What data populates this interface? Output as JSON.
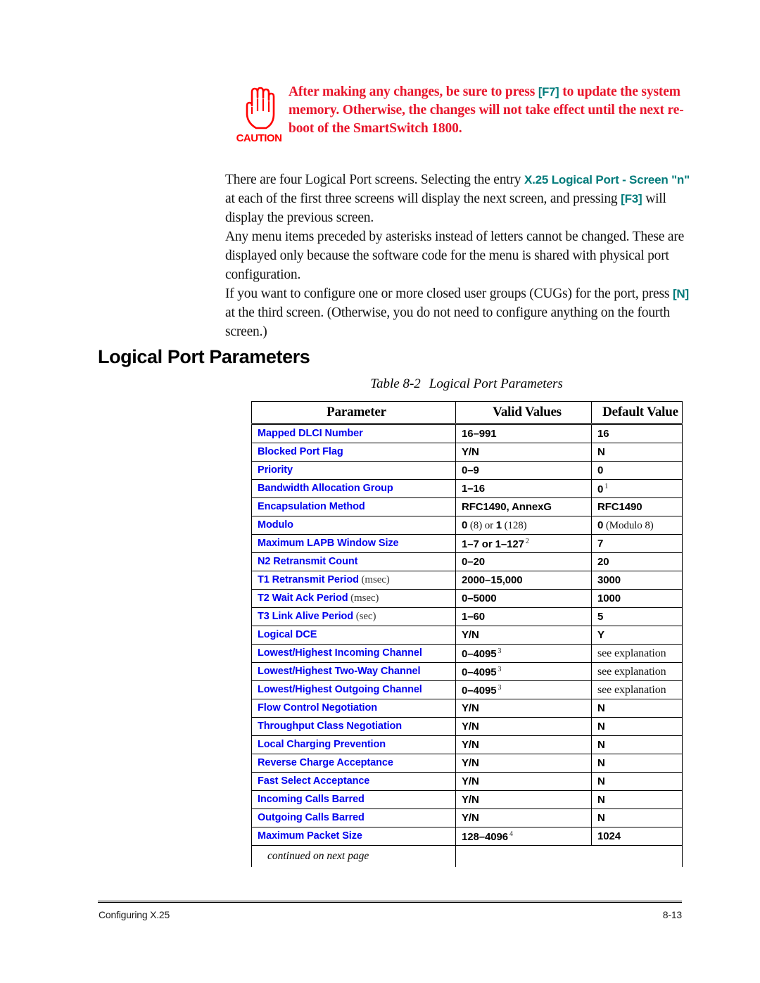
{
  "colors": {
    "caution_red": "#e8152a",
    "key_teal": "#007a7a",
    "param_blue": "#0000ee",
    "text_black": "#000000"
  },
  "caution": {
    "icon_name": "caution-hand-icon",
    "icon_label": "CAUTION",
    "text_part1": "After making any changes, be sure to press ",
    "key1": "[F7]",
    "text_part2": " to update the system memory. Otherwise, the changes will not take effect until the next re-boot of the SmartSwitch 1800."
  },
  "paragraphs": [
    {
      "id": "para1",
      "part1": "There are four Logical Port screens. Selecting the entry ",
      "kw1": "X.25 Logical Port - Screen \"n\"",
      "part2": " at each of the first three screens will display the next screen, and pressing ",
      "kw2": "[F3]",
      "part3": " will display the previous screen."
    },
    {
      "id": "para2",
      "part1": "Any menu items preceded by asterisks instead of letters cannot be changed. These are displayed only because the software code for the menu is shared with physical port configuration.",
      "kw1": "",
      "part2": "",
      "kw2": "",
      "part3": ""
    },
    {
      "id": "para3",
      "part1": "If you want to configure one or more closed user groups (CUGs) for the port, press ",
      "kw1": "[N]",
      "part2": " at the third screen. (Otherwise, you do not need to configure anything on the fourth screen.)",
      "kw2": "",
      "part3": ""
    }
  ],
  "section": {
    "heading": "Logical Port Parameters"
  },
  "table": {
    "caption_number": "Table 8-2",
    "caption_title": "Logical Port Parameters",
    "headers": [
      "Parameter",
      "Valid Values",
      "Default Value"
    ],
    "continued_note": "continued on next page",
    "rows": [
      {
        "param": "Mapped DLCI Number",
        "unit": "",
        "valid": "16–991",
        "valid_sup": "",
        "valid_note": "",
        "default": "16",
        "default_sup": "",
        "default_note": ""
      },
      {
        "param": "Blocked Port Flag",
        "unit": "",
        "valid": "Y/N",
        "valid_sup": "",
        "valid_note": "",
        "default": "N",
        "default_sup": "",
        "default_note": ""
      },
      {
        "param": "Priority",
        "unit": "",
        "valid": "0–9",
        "valid_sup": "",
        "valid_note": "",
        "default": "0",
        "default_sup": "",
        "default_note": ""
      },
      {
        "param": "Bandwidth Allocation Group",
        "unit": "",
        "valid": "1–16",
        "valid_sup": "",
        "valid_note": "",
        "default": "0",
        "default_sup": "1",
        "default_note": ""
      },
      {
        "param": "Encapsulation Method",
        "unit": "",
        "valid": "RFC1490, AnnexG",
        "valid_sup": "",
        "valid_note": "",
        "default": "RFC1490",
        "default_sup": "",
        "default_note": ""
      },
      {
        "param": "Modulo",
        "unit": "",
        "valid": "0",
        "valid_sup": "",
        "valid_note": " (8) or ",
        "default": "0",
        "default_sup": "",
        "default_note": " (Modulo 8)",
        "valid_extra_bold": "1",
        "valid_extra_note": " (128)"
      },
      {
        "param": "Maximum LAPB Window Size",
        "unit": "",
        "valid": "1–7 or 1–127",
        "valid_sup": "2",
        "valid_note": "",
        "default": "7",
        "default_sup": "",
        "default_note": ""
      },
      {
        "param": "N2 Retransmit Count",
        "unit": "",
        "valid": "0–20",
        "valid_sup": "",
        "valid_note": "",
        "default": "20",
        "default_sup": "",
        "default_note": ""
      },
      {
        "param": "T1 Retransmit Period",
        "unit": " (msec)",
        "valid": "2000–15,000",
        "valid_sup": "",
        "valid_note": "",
        "default": "3000",
        "default_sup": "",
        "default_note": ""
      },
      {
        "param": "T2 Wait Ack Period",
        "unit": " (msec)",
        "valid": "0–5000",
        "valid_sup": "",
        "valid_note": "",
        "default": "1000",
        "default_sup": "",
        "default_note": ""
      },
      {
        "param": "T3 Link Alive Period",
        "unit": " (sec)",
        "valid": "1–60",
        "valid_sup": "",
        "valid_note": "",
        "default": "5",
        "default_sup": "",
        "default_note": ""
      },
      {
        "param": "Logical DCE",
        "unit": "",
        "valid": "Y/N",
        "valid_sup": "",
        "valid_note": "",
        "default": "Y",
        "default_sup": "",
        "default_note": ""
      },
      {
        "param": "Lowest/Highest Incoming Channel",
        "unit": "",
        "valid": "0–4095",
        "valid_sup": "3",
        "valid_note": "",
        "default": "",
        "default_sup": "",
        "default_note": "see explanation"
      },
      {
        "param": "Lowest/Highest Two-Way Channel",
        "unit": "",
        "valid": "0–4095",
        "valid_sup": "3",
        "valid_note": "",
        "default": "",
        "default_sup": "",
        "default_note": "see explanation"
      },
      {
        "param": "Lowest/Highest Outgoing Channel",
        "unit": "",
        "valid": "0–4095",
        "valid_sup": "3",
        "valid_note": "",
        "default": "",
        "default_sup": "",
        "default_note": "see explanation"
      },
      {
        "param": "Flow Control Negotiation",
        "unit": "",
        "valid": "Y/N",
        "valid_sup": "",
        "valid_note": "",
        "default": "N",
        "default_sup": "",
        "default_note": ""
      },
      {
        "param": "Throughput Class Negotiation",
        "unit": "",
        "valid": "Y/N",
        "valid_sup": "",
        "valid_note": "",
        "default": "N",
        "default_sup": "",
        "default_note": ""
      },
      {
        "param": "Local Charging Prevention",
        "unit": "",
        "valid": "Y/N",
        "valid_sup": "",
        "valid_note": "",
        "default": "N",
        "default_sup": "",
        "default_note": ""
      },
      {
        "param": "Reverse Charge Acceptance",
        "unit": "",
        "valid": "Y/N",
        "valid_sup": "",
        "valid_note": "",
        "default": "N",
        "default_sup": "",
        "default_note": ""
      },
      {
        "param": "Fast Select Acceptance",
        "unit": "",
        "valid": "Y/N",
        "valid_sup": "",
        "valid_note": "",
        "default": "N",
        "default_sup": "",
        "default_note": ""
      },
      {
        "param": "Incoming Calls Barred",
        "unit": "",
        "valid": "Y/N",
        "valid_sup": "",
        "valid_note": "",
        "default": "N",
        "default_sup": "",
        "default_note": ""
      },
      {
        "param": "Outgoing Calls Barred",
        "unit": "",
        "valid": "Y/N",
        "valid_sup": "",
        "valid_note": "",
        "default": "N",
        "default_sup": "",
        "default_note": ""
      },
      {
        "param": "Maximum Packet Size",
        "unit": "",
        "valid": "128–4096",
        "valid_sup": "4",
        "valid_note": "",
        "default": "1024",
        "default_sup": "",
        "default_note": ""
      }
    ]
  },
  "footer": {
    "left": "Configuring X.25",
    "right": "8-13"
  }
}
